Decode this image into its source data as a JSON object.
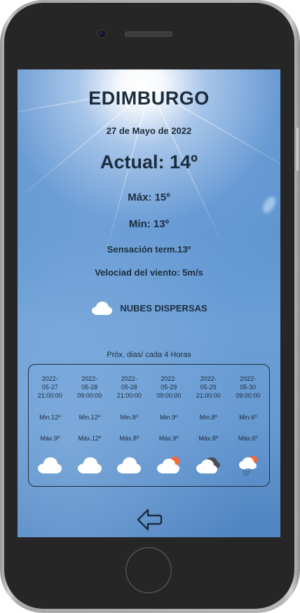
{
  "weather": {
    "city": "EDIMBURGO",
    "date": "27 de Mayo de 2022",
    "current": "Actual: 14º",
    "max": "Máx: 15º",
    "min": "Min: 13º",
    "feels_like": "Sensación term.13º",
    "wind": "Velociad del viento: 5m/s",
    "description": "NUBES DISPERSAS",
    "description_icon": "cloud-icon"
  },
  "forecast": {
    "title": "Próx. dias/ cada 4 Horas",
    "items": [
      {
        "date": "2022-\n05-27\n21:00:00",
        "min": "Min.12º",
        "max": "Máx.9º",
        "icon": "cloud-icon"
      },
      {
        "date": "2022-\n05-28\n09:00:00",
        "min": "Min.12º",
        "max": "Máx.12º",
        "icon": "cloud-icon"
      },
      {
        "date": "2022-\n05-28\n21:00:00",
        "min": "Min.8º",
        "max": "Máx.8º",
        "icon": "cloud-icon"
      },
      {
        "date": "2022-\n05-29\n09:00:00",
        "min": "Min.9º",
        "max": "Máx.9º",
        "icon": "sun-behind-cloud-icon"
      },
      {
        "date": "2022-\n05-29\n21:00:00",
        "min": "Min.8º",
        "max": "Máx.8º",
        "icon": "dark-cloud-icon"
      },
      {
        "date": "2022-\n05-30\n09:00:00",
        "min": "Min.6º",
        "max": "Máx.6º",
        "icon": "rain-cloud-icon"
      }
    ]
  },
  "navigation": {
    "back_icon": "back-arrow-icon"
  }
}
